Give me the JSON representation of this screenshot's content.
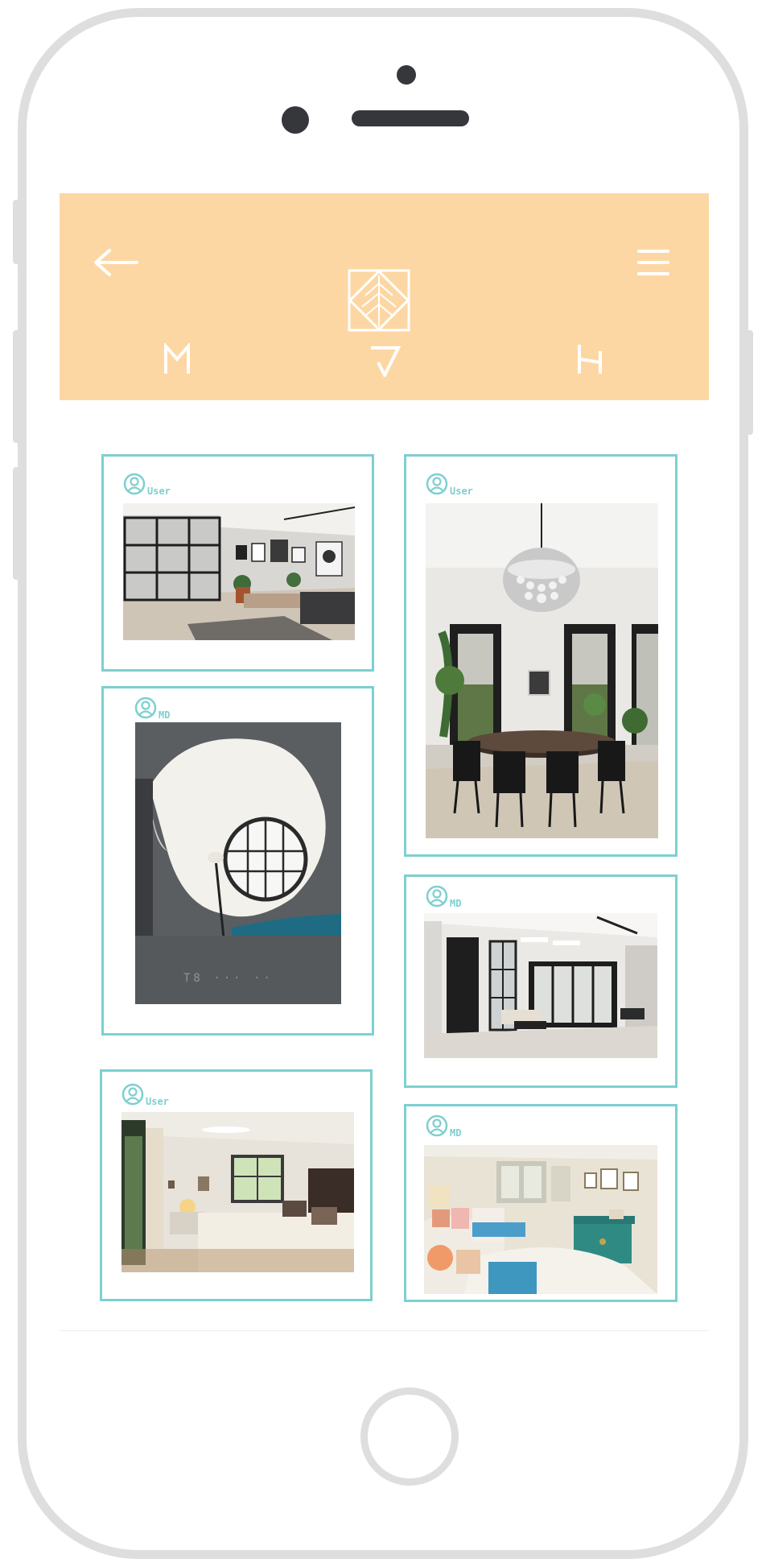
{
  "header": {
    "back_icon": "arrow-left-icon",
    "menu_icon": "hamburger-menu-icon",
    "logo_icon": "diamond-leaf-logo-icon",
    "nav_glyphs": [
      "M",
      "V",
      "H"
    ]
  },
  "cards": [
    {
      "user_label": "User",
      "user_icon": "user-avatar-icon",
      "photo": "living-room-glass-partition"
    },
    {
      "user_label": "User",
      "user_icon": "user-avatar-icon",
      "photo": "dining-room-chandelier"
    },
    {
      "user_label": "MD",
      "user_icon": "user-avatar-icon",
      "photo": "oval-window-atrium"
    },
    {
      "user_label": "MD",
      "user_icon": "user-avatar-icon",
      "photo": "modern-lounge-black-frames"
    },
    {
      "user_label": "User",
      "user_icon": "user-avatar-icon",
      "photo": "bedroom-ceiling-fan"
    },
    {
      "user_label": "MD",
      "user_icon": "user-avatar-icon",
      "photo": "bedroom-teal-dresser"
    }
  ],
  "colors": {
    "header_bg": "#fdd7a3",
    "card_border": "#7ecfd0",
    "phone_frame": "#dedede"
  }
}
